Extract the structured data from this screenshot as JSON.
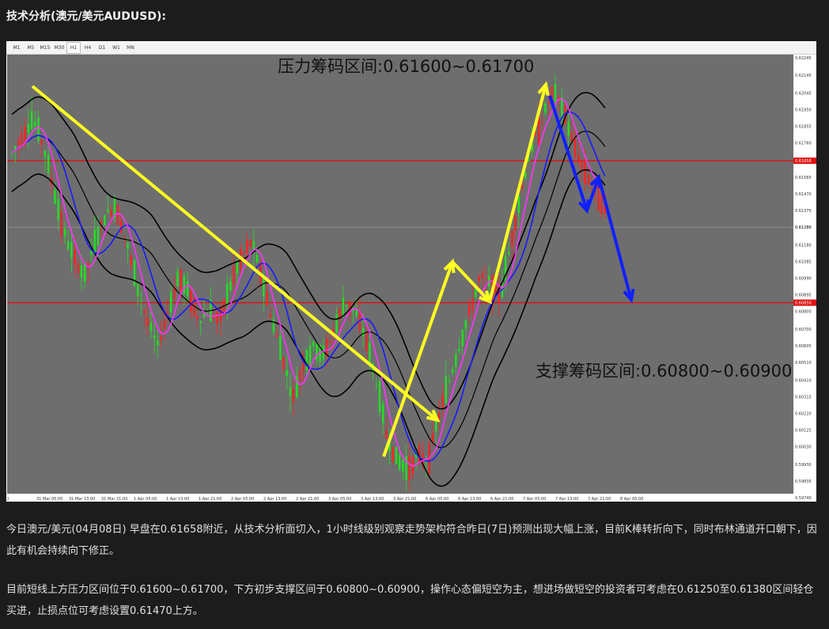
{
  "title": "技术分析(澳元/美元AUDUSD):",
  "timeframes": [
    "M1",
    "M5",
    "M15",
    "M30",
    "H1",
    "H4",
    "D1",
    "W1",
    "MN"
  ],
  "active_timeframe": "H1",
  "chart_data": {
    "type": "candlestick",
    "symbol": "AUDUSD",
    "timeframe": "H1",
    "price_axis": [
      "0.62245",
      "0.62145",
      "0.62045",
      "0.61950",
      "0.61855",
      "0.61760",
      "0.61660",
      "0.61565",
      "0.61470",
      "0.61375",
      "0.61280",
      "0.61180",
      "0.61085",
      "0.60990",
      "0.60895",
      "0.60800",
      "0.60700",
      "0.60605",
      "0.60510",
      "0.60410",
      "0.60315",
      "0.60220",
      "0.60125",
      "0.60030",
      "0.59930",
      "0.59835",
      "0.59740"
    ],
    "price_range": [
      0.5974,
      0.6224
    ],
    "time_axis": [
      "30",
      "31 Mar 05:00",
      "31 Mar 13:00",
      "31 Mar 21:00",
      "1 Apr 05:00",
      "1 Apr 13:00",
      "1 Apr 21:00",
      "2 Apr 05:00",
      "2 Apr 13:00",
      "2 Apr 21:00",
      "3 Apr 05:00",
      "3 Apr 13:00",
      "3 Apr 21:00",
      "6 Apr 05:00",
      "6 Apr 13:00",
      "6 Apr 21:00",
      "7 Apr 05:00",
      "7 Apr 13:00",
      "7 Apr 21:00",
      "8 Apr 05:00"
    ],
    "horizontal_lines": [
      {
        "price": 0.61658,
        "label": "0.61658",
        "color": "#e01010"
      },
      {
        "price": 0.6085,
        "label": "0.60850",
        "color": "#e01010"
      }
    ],
    "current_price": "0.61280",
    "annotations": {
      "resistance": "压力筹码区间:0.61600~0.61700",
      "support": "支撑筹码区间:0.60800~0.60900"
    },
    "close_path": [
      0.617,
      0.618,
      0.619,
      0.6175,
      0.615,
      0.6125,
      0.611,
      0.61,
      0.612,
      0.6135,
      0.614,
      0.612,
      0.6095,
      0.6075,
      0.606,
      0.608,
      0.61,
      0.609,
      0.6075,
      0.608,
      0.6075,
      0.6095,
      0.611,
      0.612,
      0.61,
      0.6075,
      0.6055,
      0.603,
      0.605,
      0.606,
      0.6055,
      0.607,
      0.6085,
      0.608,
      0.6065,
      0.604,
      0.601,
      0.5995,
      0.599,
      0.5998,
      0.5995,
      0.602,
      0.604,
      0.606,
      0.608,
      0.61,
      0.6095,
      0.609,
      0.612,
      0.615,
      0.6175,
      0.619,
      0.6205,
      0.6195,
      0.6175,
      0.616,
      0.615,
      0.614
    ],
    "colors": {
      "bull": "#22e022",
      "bear": "#ff2222",
      "ma_fast": "#ff33ff",
      "ma_slow": "#1a1aff",
      "bands": "#000000",
      "arrow_yellow": "#ffff22",
      "arrow_blue": "#1020ff"
    }
  },
  "paragraphs": [
    "今日澳元/美元(04月08日) 早盘在0.61658附近，从技术分析面切入，1小时线级别观察走势架构符合昨日(7日)预测出现大幅上涨，目前K棒转折向下，同时布林通道开口朝下，因此有机会持续向下修正。",
    "目前短线上方压力区间位于0.61600~0.61700，下方初步支撑区间于0.60800~0.60900，操作心态偏短空为主，想进场做短空的投资者可考虑在0.61250至0.61380区间轻仓买进，止损点位可考虑设置0.61470上方。"
  ]
}
